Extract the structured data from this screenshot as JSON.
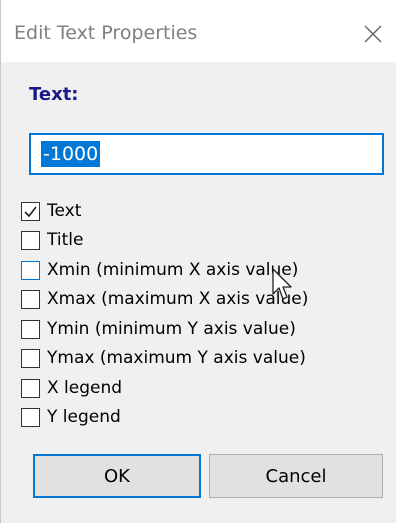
{
  "window": {
    "title": "Edit Text Properties",
    "close_glyph": "✕"
  },
  "form": {
    "text_label": "Text:",
    "text_value": "-1000"
  },
  "checkboxes": [
    {
      "label": "Text",
      "checked": true
    },
    {
      "label": "Title",
      "checked": false
    },
    {
      "label": "Xmin (minimum X axis value)",
      "checked": false,
      "focused": true
    },
    {
      "label": "Xmax (maximum X axis value)",
      "checked": false
    },
    {
      "label": "Ymin (minimum Y axis value)",
      "checked": false
    },
    {
      "label": "Ymax (maximum Y axis value)",
      "checked": false
    },
    {
      "label": "X legend",
      "checked": false
    },
    {
      "label": "Y legend",
      "checked": false
    }
  ],
  "buttons": {
    "ok_label": "OK",
    "cancel_label": "Cancel"
  },
  "colors": {
    "accent": "#0078d7",
    "label_color": "#1a1a8c",
    "client_bg": "#f0f0f0"
  }
}
